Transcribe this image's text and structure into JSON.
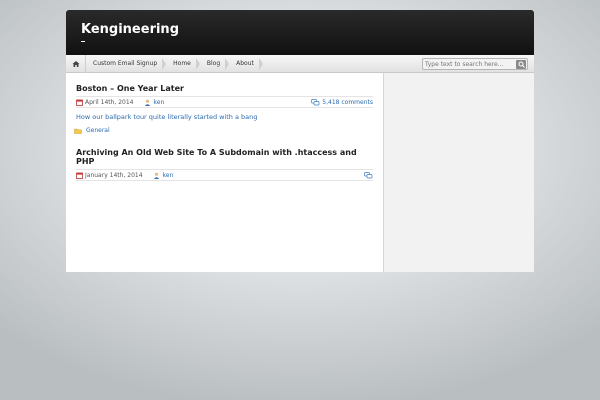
{
  "site": {
    "title": "Kengineering"
  },
  "nav": {
    "items": [
      {
        "label": "Custom Email Signup"
      },
      {
        "label": "Home"
      },
      {
        "label": "Blog"
      },
      {
        "label": "About"
      }
    ],
    "search_placeholder": "Type text to search here..."
  },
  "posts": [
    {
      "title": "Boston – One Year Later",
      "date": "April 14th, 2014",
      "author": "ken",
      "comments": "5,418 comments",
      "excerpt": "How our ballpark tour quite literally started with a bang",
      "category": "General"
    },
    {
      "title": "Archiving An Old Web Site To A Subdomain with .htaccess and PHP",
      "date": "January 14th, 2014",
      "author": "ken"
    }
  ],
  "colors": {
    "link": "#2a6cb0",
    "header": "#1a1a1a"
  }
}
